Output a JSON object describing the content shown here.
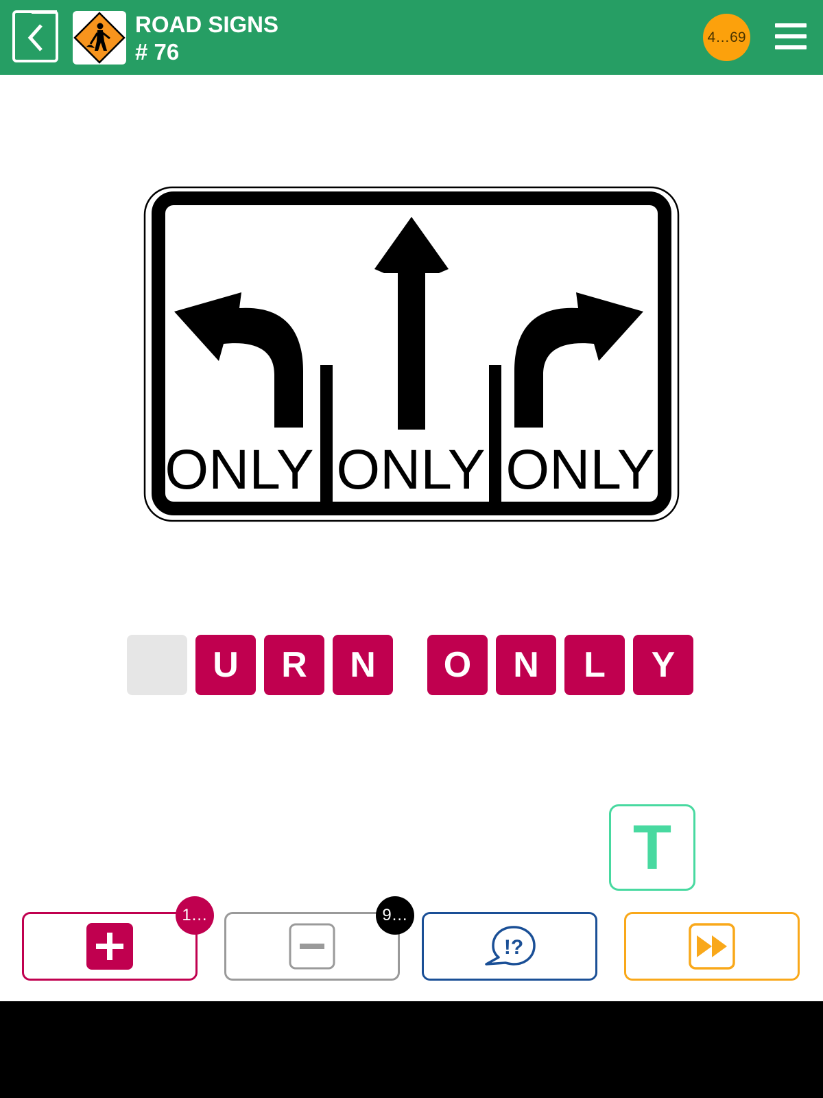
{
  "header": {
    "title": "ROAD SIGNS",
    "level_number": "# 76",
    "coins": "4…69",
    "back_icon": "chevron-left-icon",
    "category_icon": "road-work-sign-icon",
    "menu_icon": "hamburger-menu-icon"
  },
  "sign": {
    "lane_labels": [
      "ONLY",
      "ONLY",
      "ONLY"
    ]
  },
  "answer": {
    "tiles": [
      "",
      "U",
      "R",
      "N",
      "O",
      "N",
      "L",
      "Y"
    ]
  },
  "keyboard": {
    "letters": [
      "T"
    ]
  },
  "tools": {
    "add_letter_badge": "1…",
    "remove_letters_badge": "9…",
    "add_letter_icon": "plus-icon",
    "remove_letters_icon": "minus-icon",
    "ask_icon": "speech-bubble-question-icon",
    "skip_icon": "fast-forward-icon"
  },
  "colors": {
    "header": "#269e64",
    "tile": "#c0004f",
    "empty_tile": "#e6e6e6",
    "key": "#48d9a0",
    "coin": "#fca10c",
    "add": "#c0004f",
    "remove": "#9a9a9a",
    "ask": "#1a4f96",
    "skip": "#f9a81a"
  }
}
